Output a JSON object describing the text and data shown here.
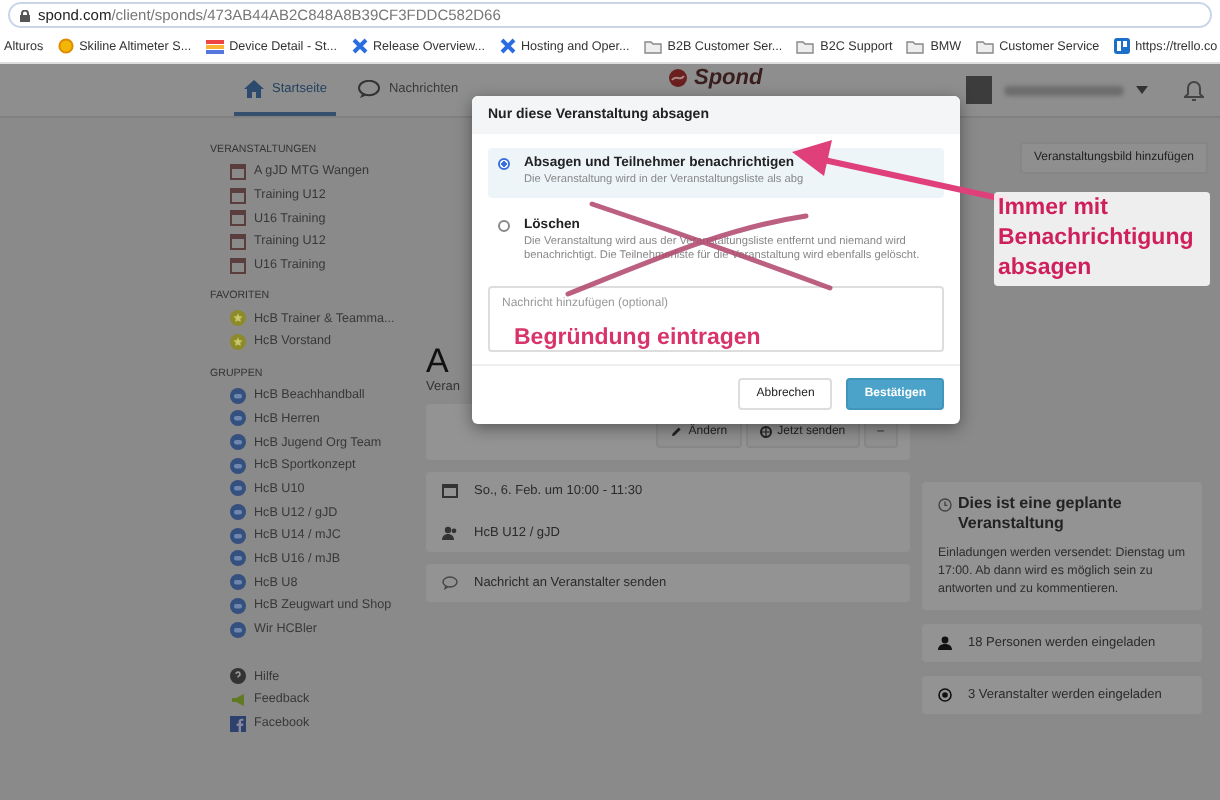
{
  "browser": {
    "url_host": "spond.com",
    "url_path": "/client/sponds/473AB44AB2C848A8B39CF3FDDC582D66",
    "bookmarks": [
      {
        "label": "Alturos",
        "kind": "plain"
      },
      {
        "label": "Skiline Altimeter S...",
        "kind": "site"
      },
      {
        "label": "Device Detail - St...",
        "kind": "dashboard"
      },
      {
        "label": "Release Overview...",
        "kind": "tracker"
      },
      {
        "label": "Hosting and Oper...",
        "kind": "tracker"
      },
      {
        "label": "B2B Customer Ser...",
        "kind": "folder"
      },
      {
        "label": "B2C Support",
        "kind": "folder"
      },
      {
        "label": "BMW",
        "kind": "folder"
      },
      {
        "label": "Customer Service",
        "kind": "folder"
      },
      {
        "label": "https://trello.co",
        "kind": "board"
      }
    ]
  },
  "nav": {
    "tabs": [
      {
        "label": "Startseite",
        "kind": "home",
        "selected": true
      },
      {
        "label": "Nachrichten",
        "kind": "chat",
        "selected": false
      }
    ],
    "logo": "Spond"
  },
  "sidebar": {
    "sections": [
      {
        "title": "VERANSTALTUNGEN",
        "kind": "event",
        "items": [
          "A gJD MTG Wangen",
          "Training U12",
          "U16 Training",
          "Training U12",
          "U16 Training"
        ]
      },
      {
        "title": "FAVORITEN",
        "kind": "favorite",
        "items": [
          "HcB Trainer & Teamma...",
          "HcB Vorstand"
        ]
      },
      {
        "title": "GRUPPEN",
        "kind": "group",
        "items": [
          "HcB Beachhandball",
          "HcB Herren",
          "HcB Jugend Org Team",
          "HcB Sportkonzept",
          "HcB U10",
          "HcB U12 / gJD",
          "HcB U14 / mJC",
          "HcB U16 / mJB",
          "HcB U8",
          "HcB Zeugwart und Shop",
          "Wir HCBler"
        ]
      }
    ],
    "links": [
      {
        "label": "Hilfe",
        "kind": "help"
      },
      {
        "label": "Feedback",
        "kind": "feedback"
      },
      {
        "label": "Facebook",
        "kind": "facebook"
      }
    ]
  },
  "event": {
    "title": "A",
    "subtitle": "Veran",
    "actions": [
      {
        "label": "Ändern",
        "kind": "edit"
      },
      {
        "label": "Jetzt senden",
        "kind": "send"
      },
      {
        "label": "–",
        "kind": "more"
      }
    ],
    "date": "So., 6. Feb. um 10:00 - 11:30",
    "group": "HcB U12 / gJD",
    "message_link": "Nachricht an Veranstalter senden"
  },
  "aside": {
    "image_button": "Veranstaltungsbild hinzufügen",
    "scheduled_title": "Dies ist eine geplante Veranstaltung",
    "scheduled_text": "Einladungen werden versendet: Dienstag um 17:00. Ab dann wird es möglich sein zu antworten und zu kommentieren.",
    "invitees": "18 Personen werden eingeladen",
    "organizers": "3 Veranstalter werden eingeladen"
  },
  "dialog": {
    "title": "Nur diese Veranstaltung absagen",
    "options": [
      {
        "label": "Absagen und Teilnehmer benachrichtigen",
        "description": "Die Veranstaltung wird in der Veranstaltungsliste als abg",
        "selected": true
      },
      {
        "label": "Löschen",
        "description": "Die Veranstaltung wird aus der Veranstaltungsliste entfernt und niemand wird benachrichtigt. Die Teilnehmerliste für die Veranstaltung wird ebenfalls gelöscht.",
        "selected": false
      }
    ],
    "message_placeholder": "Nachricht hinzufügen (optional)",
    "buttons": [
      {
        "label": "Abbrechen",
        "kind": "secondary"
      },
      {
        "label": "Bestätigen",
        "kind": "primary"
      }
    ]
  },
  "annotations": {
    "callout": "Immer mit Benachrichtigung absagen",
    "note": "Begründung eintragen"
  }
}
